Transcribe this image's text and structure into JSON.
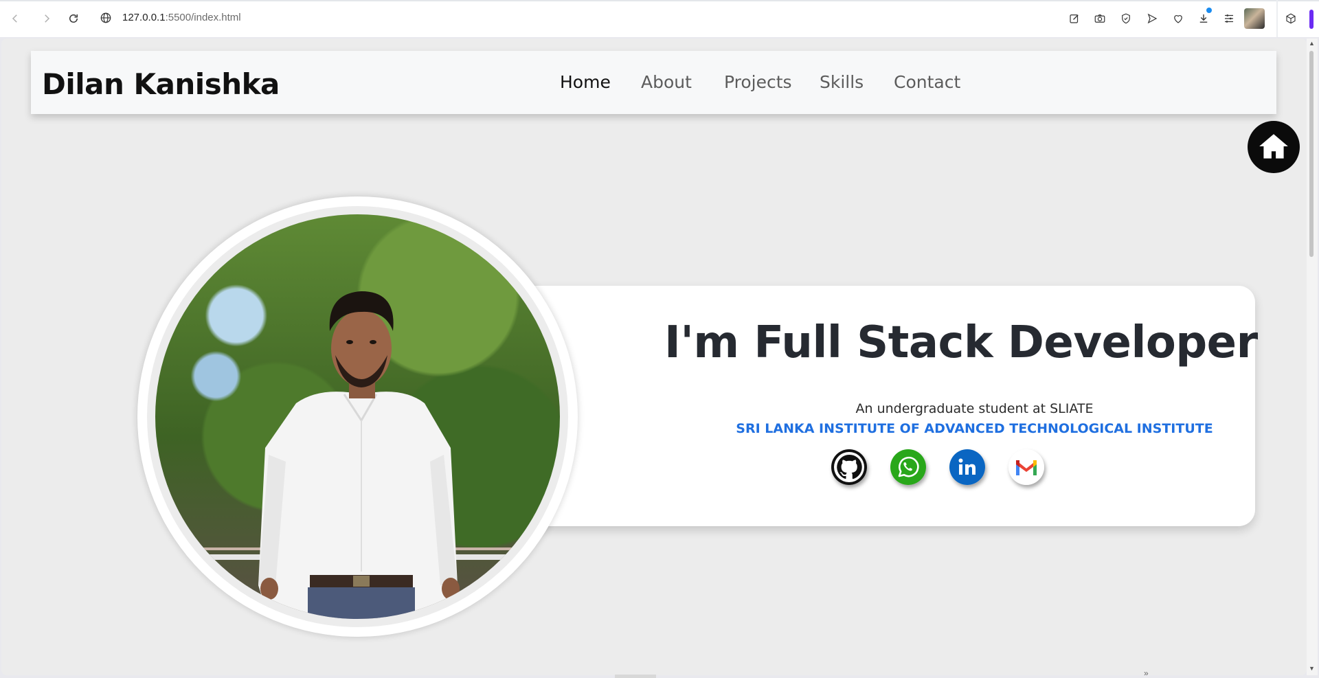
{
  "browser": {
    "url_host": "127.0.0.1",
    "url_rest": ":5500/index.html",
    "icons": [
      "back-icon",
      "forward-icon",
      "reload-icon",
      "globe-icon",
      "edit-icon",
      "camera-icon",
      "shield-icon",
      "send-icon",
      "heart-icon",
      "download-icon",
      "menu-icon",
      "avatar",
      "cube-icon"
    ]
  },
  "navbar": {
    "brand": "Dilan Kanishka",
    "links": [
      {
        "label": "Home",
        "active": true
      },
      {
        "label": "About",
        "active": false
      },
      {
        "label": "Projects",
        "active": false
      },
      {
        "label": "Skills",
        "active": false
      },
      {
        "label": "Contact",
        "active": false
      }
    ]
  },
  "hero": {
    "title": "I'm Full Stack Developer",
    "subtitle": "An undergraduate student at SLIATE",
    "institute": "SRI LANKA INSTITUTE OF ADVANCED TECHNOLOGICAL INSTITUTE",
    "socials": [
      "github-icon",
      "whatsapp-icon",
      "linkedin-icon",
      "gmail-icon"
    ]
  },
  "colors": {
    "accent": "#1f6fe0",
    "page_bg": "#ececec",
    "nav_bg": "#f7f8f9",
    "title": "#262a31"
  },
  "fab": {
    "icon": "home-icon"
  }
}
